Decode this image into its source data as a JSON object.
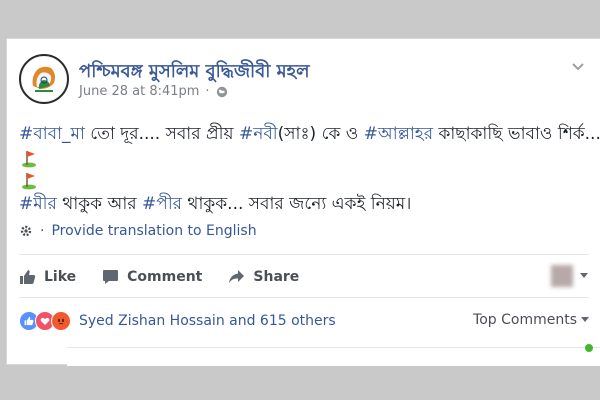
{
  "page": {
    "name": "পশ্চিমবঙ্গ মুসলিম বুদ্ধিজীবী মহল"
  },
  "post": {
    "date": "June 28 at 8:41pm",
    "dot": "·",
    "line1": {
      "h1": "#বাবা_মা",
      "t1": " তো দূর.... সবার প্রীয় ",
      "h2": "#নবী",
      "t2": "(সাঃ) কে ও ",
      "h3": "#আল্লাহর",
      "t3": " কাছাকাছি ভাবাও শির্ক...."
    },
    "line2": {
      "h1": "#মীর",
      "t1": " থাকুক আর ",
      "h2": "#পীর",
      "t2": " থাকুক... সবার জন্যে একই নিয়ম।"
    },
    "translate": "Provide translation to English"
  },
  "actions": {
    "like": "Like",
    "comment": "Comment",
    "share": "Share"
  },
  "reactions": {
    "text": "Syed Zishan Hossain and 615 others",
    "top_comments": "Top Comments"
  },
  "colors": {
    "link": "#365899",
    "page_name": "#3b5998",
    "online": "#42b72a"
  }
}
